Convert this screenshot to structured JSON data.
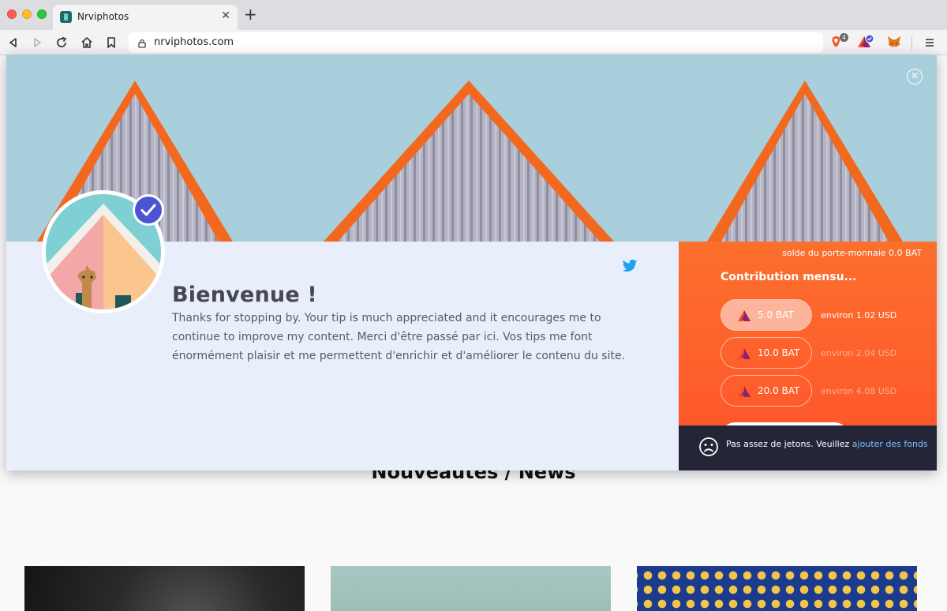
{
  "browser": {
    "tab_title": "Nrviphotos",
    "tab_close": "✕",
    "new_tab": "+",
    "url": "nrviphotos.com",
    "brave_badge": "4"
  },
  "page": {
    "heading": "Nouveautés / News"
  },
  "tip_modal": {
    "close_glyph": "✕",
    "welcome": "Bienvenue !",
    "message": "Thanks for stopping by. Your tip is much appreciated and it encourages me to continue to improve my content. Merci d'être passé par ici. Vos tips me font énormément plaisir et me permettent d'enrichir et d'améliorer le contenu du site.",
    "wallet": {
      "balance": "solde du porte-monnaie 0.0 BAT",
      "contribution_title": "Contribution mensu...",
      "amounts": [
        {
          "label": "5.0 BAT",
          "usd": "environ 1.02 USD",
          "selected": true
        },
        {
          "label": "10.0 BAT",
          "usd": "environ 2.04 USD",
          "selected": false
        },
        {
          "label": "20.0 BAT",
          "usd": "environ 4.08 USD",
          "selected": false
        }
      ],
      "notice_text": "Pas assez de jetons. Veuillez ",
      "notice_link": "ajouter des fonds"
    }
  },
  "colors": {
    "brand_orange": "#fc6f2c",
    "bat_purple": "#4c54d2",
    "notice_bg": "#242638",
    "link_blue": "#7fc0ff"
  },
  "icons": [
    "back-icon",
    "forward-icon",
    "reload-icon",
    "home-icon",
    "bookmark-icon",
    "lock-icon",
    "brave-shield-icon",
    "brave-rewards-icon",
    "metamask-fox-icon",
    "menu-icon",
    "close-icon",
    "twitter-icon",
    "verified-check-icon",
    "bat-logo-icon",
    "frown-icon"
  ]
}
